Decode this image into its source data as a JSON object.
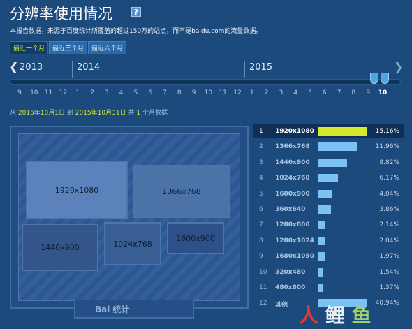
{
  "title": "分辨率使用情况",
  "help_icon": "?",
  "description": "本报告数据，来源于百度统计所覆盖的超过150万的站点，而不是baidu.com的流量数据。",
  "range_tabs": [
    "最近一个月",
    "最近三个月",
    "最近六个月"
  ],
  "timeline": {
    "prev_icon": "chevron-left-icon",
    "next_icon": "chevron-right-icon",
    "years": [
      "2013",
      "2014",
      "2015"
    ],
    "months": [
      "9",
      "10",
      "11",
      "12",
      "1",
      "2",
      "3",
      "4",
      "5",
      "6",
      "7",
      "8",
      "9",
      "10",
      "11",
      "12",
      "1",
      "2",
      "3",
      "4",
      "5",
      "6",
      "7",
      "8",
      "9",
      "10"
    ],
    "active_month_index": 25
  },
  "daterange": {
    "from_label": "从",
    "start": "2015年10月1日",
    "to_label": "到",
    "end": "2015年10月31日",
    "total_label": "共",
    "count": "1",
    "unit": "个月数据"
  },
  "monitor_boxes": [
    "1920x1080",
    "1366x768",
    "1440x900",
    "1024x768",
    "1600x900"
  ],
  "monitor_logo": "Bai 统计",
  "ranking": [
    {
      "rank": "1",
      "res": "1920x1080",
      "pct": "15.16%",
      "value": 15.16
    },
    {
      "rank": "2",
      "res": "1366x768",
      "pct": "11.96%",
      "value": 11.96
    },
    {
      "rank": "3",
      "res": "1440x900",
      "pct": "8.82%",
      "value": 8.82
    },
    {
      "rank": "4",
      "res": "1024x768",
      "pct": "6.17%",
      "value": 6.17
    },
    {
      "rank": "5",
      "res": "1600x900",
      "pct": "4.04%",
      "value": 4.04
    },
    {
      "rank": "6",
      "res": "360x640",
      "pct": "3.86%",
      "value": 3.86
    },
    {
      "rank": "7",
      "res": "1280x800",
      "pct": "2.14%",
      "value": 2.14
    },
    {
      "rank": "8",
      "res": "1280x1024",
      "pct": "2.04%",
      "value": 2.04
    },
    {
      "rank": "9",
      "res": "1680x1050",
      "pct": "1.97%",
      "value": 1.97
    },
    {
      "rank": "10",
      "res": "320x480",
      "pct": "1.54%",
      "value": 1.54
    },
    {
      "rank": "11",
      "res": "480x800",
      "pct": "1.37%",
      "value": 1.37
    },
    {
      "rank": "12",
      "res": "其他",
      "pct": "40.94%",
      "value": 40.94
    }
  ],
  "watermark": {
    "a": "人",
    "b": "鲤",
    "c": "鱼"
  },
  "colors": {
    "background": "#1d4a7c",
    "accent_green": "#d4e92c",
    "bar_blue": "#7cc1f3",
    "date_highlight": "#c8e23a"
  }
}
